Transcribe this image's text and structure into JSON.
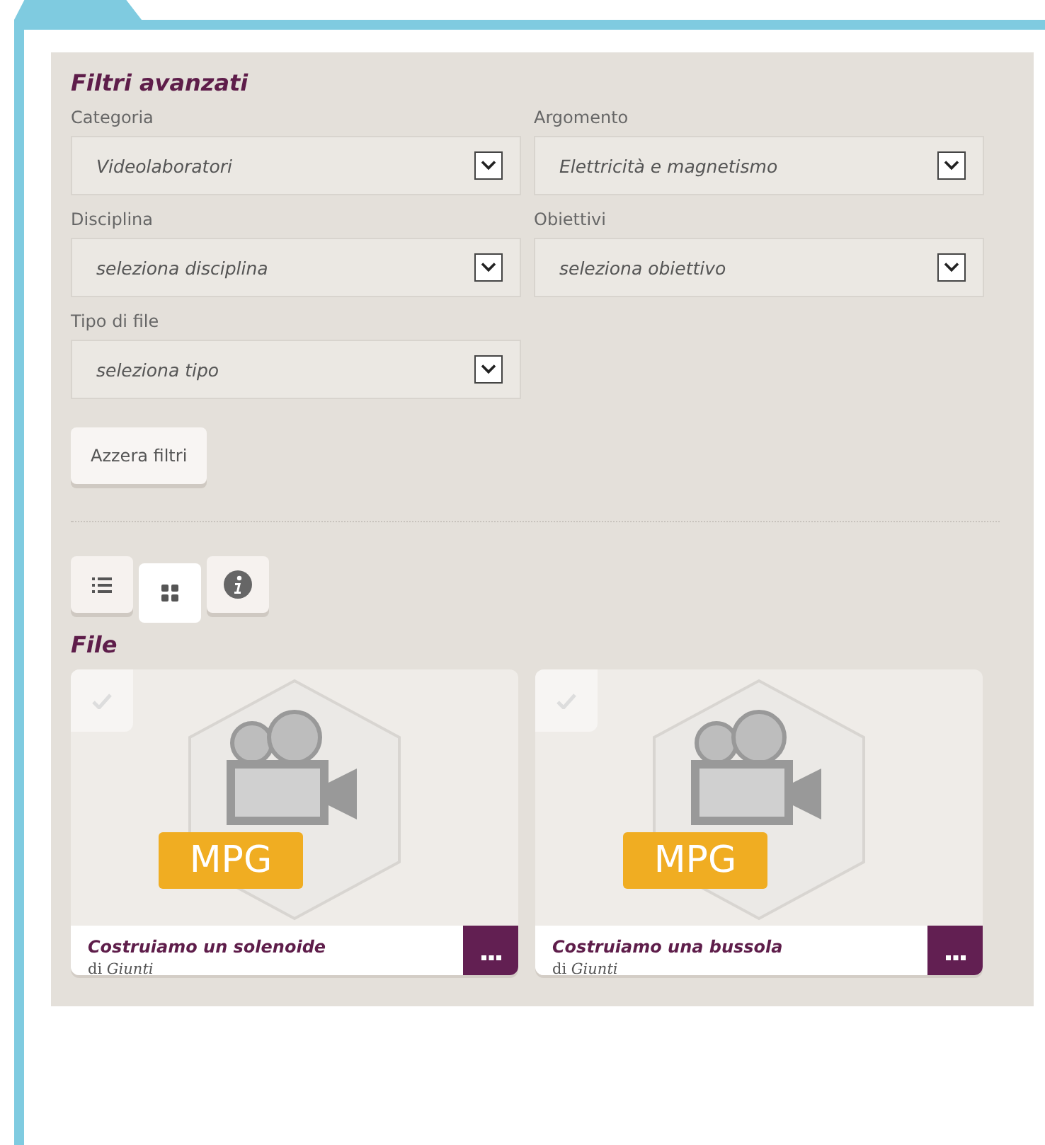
{
  "title": "Filtri avanzati",
  "filters": [
    {
      "label": "Categoria",
      "value": "Videolaboratori"
    },
    {
      "label": "Argomento",
      "value": "Elettricità e magnetismo"
    },
    {
      "label": "Disciplina",
      "value": "seleziona disciplina"
    },
    {
      "label": "Obiettivi",
      "value": "seleziona obiettivo"
    },
    {
      "label": "Tipo di file",
      "value": "seleziona tipo"
    }
  ],
  "reset_button": "Azzera filtri",
  "view_toggles": [
    {
      "kind": "list",
      "selected": false
    },
    {
      "kind": "grid",
      "selected": true
    },
    {
      "kind": "info",
      "selected": false
    }
  ],
  "files_title": "File",
  "files": [
    {
      "badge": "MPG",
      "title": "Costruiamo un solenoide",
      "author": "di *Giunti*",
      "checked": false
    },
    {
      "badge": "MPG",
      "title": "Costruiamo una bussola",
      "author": "di *Giunti*",
      "checked": false
    }
  ]
}
